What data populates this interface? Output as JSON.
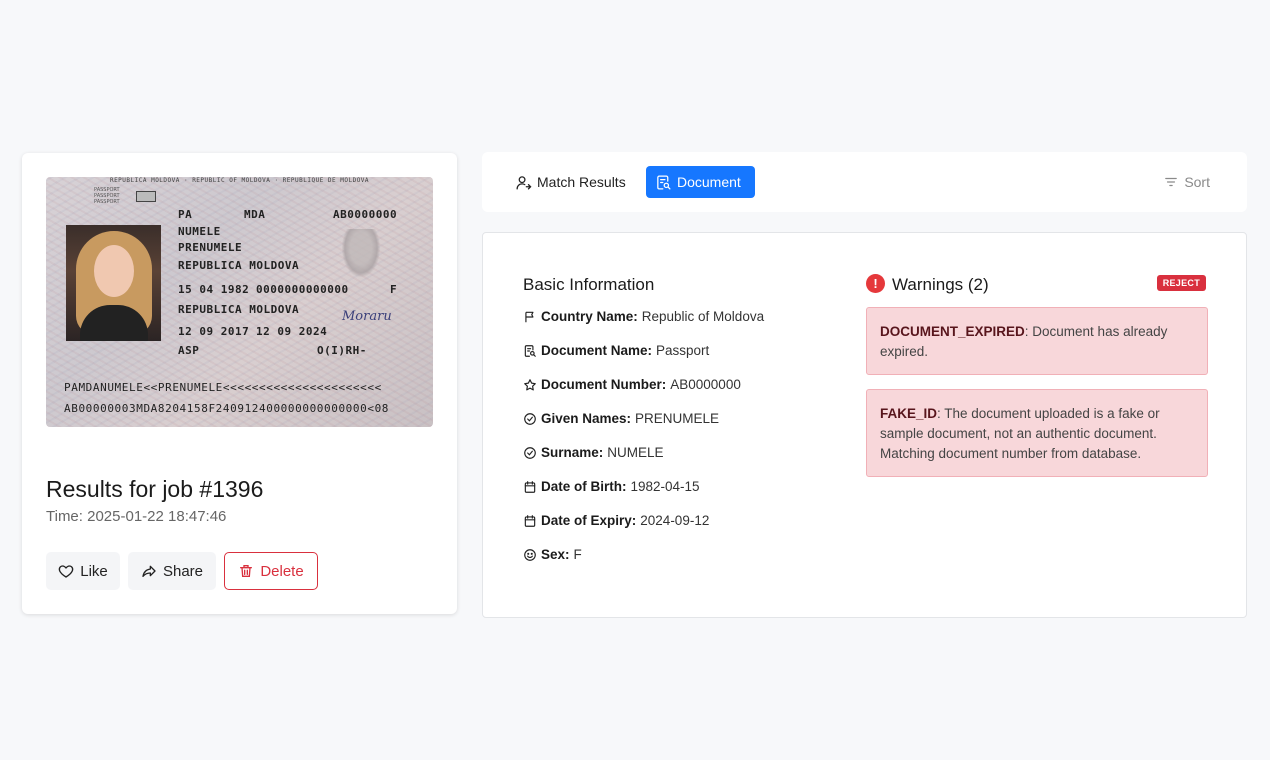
{
  "passport": {
    "header": "REPUBLICA MOLDOVA · REPUBLIC OF MOLDOVA · RÉPUBLIQUE DE MOLDOVA",
    "doc_label": "PASSPORT",
    "type": "PA",
    "country_code": "MDA",
    "passport_no": "AB0000000",
    "surname": "NUMELE",
    "given_names": "PRENUMELE",
    "nationality": "REPUBLICA MOLDOVA",
    "birth_date": "15 04 1982",
    "personal_no": "0000000000000",
    "sex": "F",
    "birth_place": "REPUBLICA MOLDOVA",
    "issue_date": "12 09 2017",
    "expiry_date": "12 09 2024",
    "authority": "ASP",
    "blood_group": "O(I)RH-",
    "signature": "Moraru",
    "mrz_line1": "PAMDANUMELE<<PRENUMELE<<<<<<<<<<<<<<<<<<<<<<",
    "mrz_line2": "AB00000003MDA8204158F240912400000000000000<08"
  },
  "job": {
    "title": "Results for job #1396",
    "time": "Time: 2025-01-22 18:47:46"
  },
  "actions": {
    "like": "Like",
    "share": "Share",
    "delete": "Delete"
  },
  "tabs": {
    "match": "Match Results",
    "document": "Document",
    "sort": "Sort"
  },
  "basic": {
    "title": "Basic Information",
    "rows": [
      {
        "label": "Country Name:",
        "value": "Republic of Moldova",
        "icon": "flag-icon"
      },
      {
        "label": "Document Name:",
        "value": "Passport",
        "icon": "document-icon"
      },
      {
        "label": "Document Number:",
        "value": "AB0000000",
        "icon": "star-icon"
      },
      {
        "label": "Given Names:",
        "value": "PRENUMELE",
        "icon": "check-circle-icon"
      },
      {
        "label": "Surname:",
        "value": "NUMELE",
        "icon": "check-circle-icon"
      },
      {
        "label": "Date of Birth:",
        "value": "1982-04-15",
        "icon": "calendar-icon"
      },
      {
        "label": "Date of Expiry:",
        "value": "2024-09-12",
        "icon": "calendar-icon"
      },
      {
        "label": "Sex:",
        "value": "F",
        "icon": "smile-icon"
      }
    ]
  },
  "warnings": {
    "title": "Warnings (2)",
    "badge": "REJECT",
    "items": [
      {
        "code": "DOCUMENT_EXPIRED",
        "text": ": Document has already expired."
      },
      {
        "code": "FAKE_ID",
        "text": ": The document uploaded is a fake or sample document, not an authentic document. Matching document number from database."
      }
    ]
  },
  "colors": {
    "primary": "#1677ff",
    "danger": "#d9303e",
    "warning_bg": "#f8d7da"
  }
}
